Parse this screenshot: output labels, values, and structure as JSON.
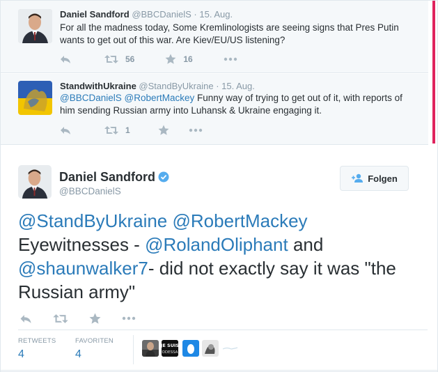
{
  "context_tweets": [
    {
      "name": "Daniel Sandford",
      "handle": "@BBCDanielS",
      "dot": "·",
      "date": "15. Aug.",
      "text_parts": [
        {
          "t": "For all the madness today, Some Kremlinologists are seeing signs that Pres Putin wants to get out of this war. Are Kiev/EU/US listening?",
          "mention": false
        }
      ],
      "retweets": "56",
      "favorites": "16"
    },
    {
      "name": "StandwithUkraine",
      "handle": "@StandByUkraine",
      "dot": "·",
      "date": "15. Aug.",
      "text_parts": [
        {
          "t": "@BBCDanielS",
          "mention": true
        },
        {
          "t": " ",
          "mention": false
        },
        {
          "t": "@RobertMackey",
          "mention": true
        },
        {
          "t": " Funny way of trying to get out of it, with reports of him sending Russian army into Luhansk & Ukraine engaging it.",
          "mention": false
        }
      ],
      "retweets": "1",
      "favorites": ""
    }
  ],
  "main_tweet": {
    "name": "Daniel Sandford",
    "handle": "@BBCDanielS",
    "follow_label": "Folgen",
    "text_parts": [
      {
        "t": "@StandByUkraine",
        "mention": true
      },
      {
        "t": " ",
        "mention": false
      },
      {
        "t": "@RobertMackey",
        "mention": true
      },
      {
        "t": " Eyewitnesses - ",
        "mention": false
      },
      {
        "t": "@RolandOliphant",
        "mention": true
      },
      {
        "t": " and ",
        "mention": false
      },
      {
        "t": "@shaunwalker7",
        "mention": true
      },
      {
        "t": "-  did not exactly say it was \"the Russian army\"",
        "mention": false
      }
    ],
    "stats": {
      "retweets_label": "RETWEETS",
      "retweets": "4",
      "favorites_label": "FAVORITEN",
      "favorites": "4"
    },
    "favoriter_avatars": [
      "person-photo",
      "je-suis-odessa",
      "blue-drop",
      "sketch-portrait"
    ],
    "favoriter_texts": [
      "JE SUIS",
      "ODESSA"
    ]
  },
  "colors": {
    "link": "#2b7bb9",
    "muted": "#8899a6",
    "icon": "#aab8c2",
    "verified": "#55acee",
    "context_bg": "#f5f8fa",
    "scroll_red": "#e0245e"
  },
  "icons": {
    "reply": "reply-icon",
    "retweet": "retweet-icon",
    "favorite": "star-icon",
    "more": "more-icon",
    "verified": "verified-badge-icon",
    "follow": "follow-person-icon"
  }
}
